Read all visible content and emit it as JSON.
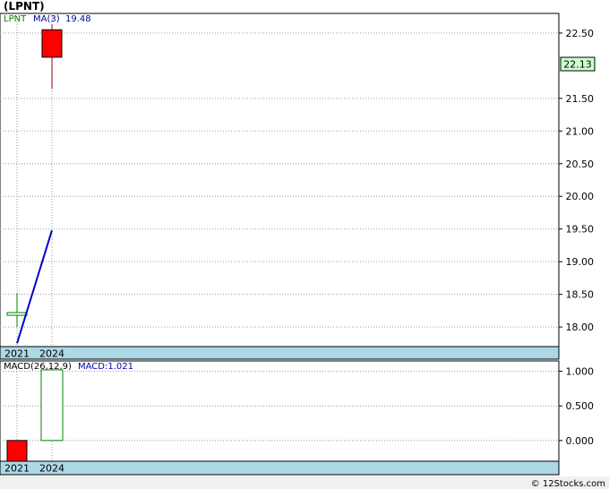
{
  "title": "(LPNT)",
  "legend": {
    "symbol": "LPNT",
    "ma_label": "MA(3)",
    "ma_value": "19.48",
    "macd_label": "MACD(26,12,9)",
    "macd_value_label": "MACD:1.021"
  },
  "last_price_tag": "22.13",
  "footer": "© 12Stocks.com",
  "colors": {
    "up": "#008000",
    "down": "#ff0000",
    "ma": "#0000cc",
    "axis_band": "#add8e6",
    "price_tag_bg": "#ccffcc",
    "symbol_text": "#008000",
    "ma_text": "#000099"
  },
  "chart_data": [
    {
      "type": "candlestick",
      "panel": "price",
      "x": [
        "2021",
        "2024"
      ],
      "candles": [
        {
          "x": "2021",
          "open": 18.2,
          "high": 18.52,
          "low": 18.0,
          "close": 18.2,
          "direction": "flat"
        },
        {
          "x": "2024",
          "open": 22.55,
          "high": 22.63,
          "low": 21.65,
          "close": 22.13,
          "direction": "down"
        }
      ],
      "ma_series": {
        "name": "MA(3)",
        "values": [
          17.75,
          19.48
        ]
      },
      "yticks": [
        18.0,
        18.5,
        19.0,
        19.5,
        20.0,
        20.5,
        21.0,
        21.5,
        22.5
      ],
      "yticklabels": [
        "18.00",
        "18.50",
        "19.00",
        "19.50",
        "20.00",
        "20.50",
        "21.00",
        "21.50",
        "22.50"
      ],
      "ylim": [
        17.7,
        22.8
      ],
      "grid": true
    },
    {
      "type": "bar",
      "panel": "macd",
      "categories": [
        "2021",
        "2024"
      ],
      "values": [
        -0.03,
        1.021
      ],
      "yticks": [
        0.0,
        0.5,
        1.0
      ],
      "yticklabels": [
        "0.000",
        "0.500",
        "1.000"
      ],
      "ylim": [
        -0.3,
        1.15
      ],
      "grid": true
    }
  ]
}
